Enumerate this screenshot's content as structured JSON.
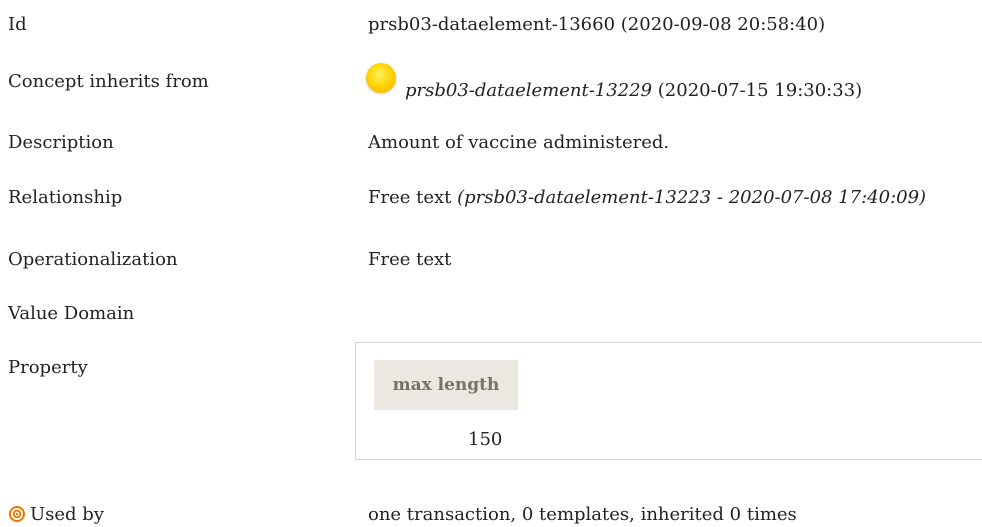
{
  "rows": {
    "id": {
      "label": "Id",
      "value": "prsb03-dataelement-13660 (2020-09-08 20:58:40)"
    },
    "inherits": {
      "label": "Concept inherits from",
      "ref": "prsb03-dataelement-13229",
      "date": "(2020-07-15 19:30:33)",
      "icon": "yellow-orb-icon"
    },
    "description": {
      "label": "Description",
      "value": "Amount of vaccine administered."
    },
    "relationship": {
      "label": "Relationship",
      "value": "Free text",
      "ref": "(prsb03-dataelement-13223 - 2020-07-08 17:40:09)"
    },
    "operationalization": {
      "label": "Operationalization",
      "value": "Free text"
    },
    "value_domain": {
      "label": "Value Domain"
    },
    "property": {
      "label": "Property",
      "header": "max length",
      "value": "150"
    },
    "used_by": {
      "label": "Used by",
      "value": "one transaction, 0 templates, inherited 0 times",
      "icon": "target-icon"
    }
  },
  "colors": {
    "header_bg": "#ebe7e1",
    "header_text": "#7a7064",
    "orb": "#ffd400",
    "target": "#f07800"
  }
}
